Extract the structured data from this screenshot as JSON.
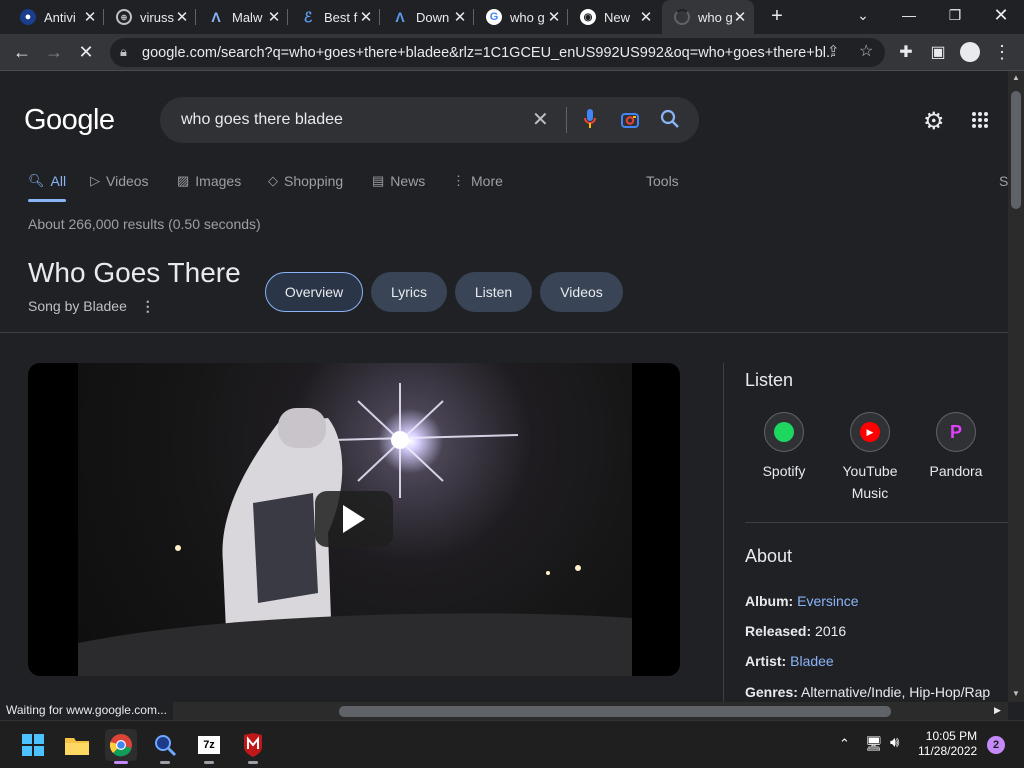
{
  "tabs": [
    {
      "title": "Antivi",
      "icon": "shield-icon",
      "color": "#1a4fb3"
    },
    {
      "title": "viruss",
      "icon": "globe-icon",
      "color": "#5f6368"
    },
    {
      "title": "Malw",
      "icon": "malwarebytes-icon",
      "color": "#2f7bd0"
    },
    {
      "title": "Best f",
      "icon": "edge-icon",
      "color": "#3a7bd5"
    },
    {
      "title": "Down",
      "icon": "malwarebytes-icon",
      "color": "#2f7bd0"
    },
    {
      "title": "who g",
      "icon": "google-icon",
      "color": "#ffffff"
    },
    {
      "title": "New",
      "icon": "chrome-icon",
      "color": "#ffffff"
    },
    {
      "title": "who g",
      "icon": "loading-icon",
      "color": "#9aa0a6"
    }
  ],
  "browser": {
    "url": "google.com/search?q=who+goes+there+bladee&rlz=1C1GCEU_enUS992US992&oq=who+goes+there+bl...",
    "status": "Waiting for www.google.com..."
  },
  "search": {
    "logo": "Google",
    "query": "who goes there bladee",
    "nav": [
      "All",
      "Videos",
      "Images",
      "Shopping",
      "News",
      "More"
    ],
    "tools": "Tools",
    "cut": "S",
    "stats": "About 266,000 results (0.50 seconds)"
  },
  "kp": {
    "title": "Who Goes There",
    "subtitle": "Song by Bladee",
    "chips": [
      "Overview",
      "Lyrics",
      "Listen",
      "Videos"
    ],
    "listen_heading": "Listen",
    "services": [
      {
        "name": "Spotify",
        "color": "#1ed760"
      },
      {
        "name": "YouTube Music",
        "color": "#ff0000"
      },
      {
        "name": "Pandora",
        "color": "#e040fb"
      }
    ],
    "about_heading": "About",
    "facts": [
      {
        "label": "Album:",
        "value": "Eversince",
        "link": true
      },
      {
        "label": "Released:",
        "value": "2016",
        "link": false
      },
      {
        "label": "Artist:",
        "value": "Bladee",
        "link": true
      },
      {
        "label": "Genres:",
        "value": "Alternative/Indie, Hip-Hop/Rap",
        "link": false
      }
    ]
  },
  "taskbar": {
    "time": "10:05 PM",
    "date": "11/28/2022",
    "notifications": "2",
    "apps": [
      "windows-start-icon",
      "file-explorer-icon",
      "chrome-icon",
      "magnifier-app-icon",
      "7zip-icon",
      "mcafee-icon"
    ]
  },
  "colors": {
    "accent": "#8ab4f8",
    "bg": "#202124",
    "chip": "#394457"
  }
}
